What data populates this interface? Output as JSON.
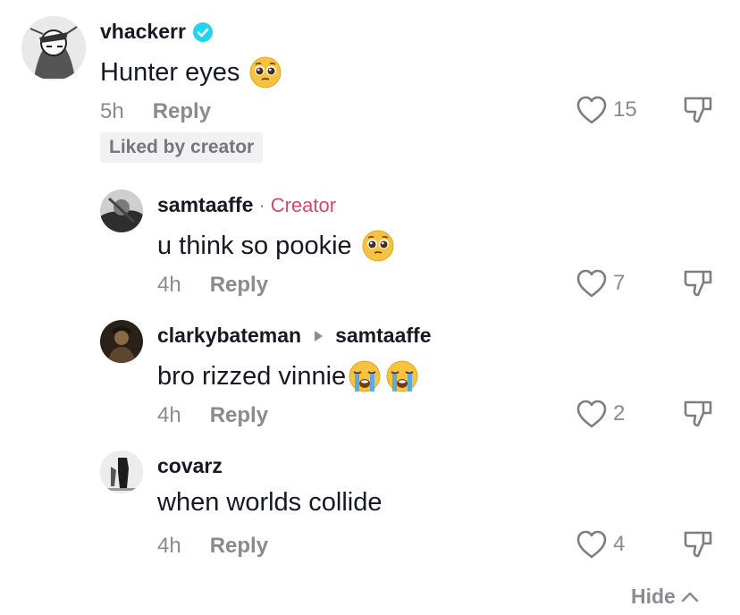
{
  "comments": [
    {
      "username": "vhackerr",
      "verified": true,
      "text": "Hunter eyes",
      "emojis": [
        "pleading-face"
      ],
      "time": "5h",
      "reply_label": "Reply",
      "likes": "15",
      "liked_by_creator": "Liked by creator"
    },
    {
      "username": "samtaaffe",
      "separator": "·",
      "creator_tag": "Creator",
      "text": "u think so pookie",
      "emojis": [
        "pleading-face"
      ],
      "time": "4h",
      "reply_label": "Reply",
      "likes": "7"
    },
    {
      "username": "clarkybateman",
      "replying_to": "samtaaffe",
      "text": "bro rizzed vinnie",
      "emojis": [
        "loudly-crying-face",
        "loudly-crying-face"
      ],
      "time": "4h",
      "reply_label": "Reply",
      "likes": "2"
    },
    {
      "username": "covarz",
      "text": "when worlds collide",
      "time": "4h",
      "reply_label": "Reply",
      "likes": "4"
    }
  ],
  "hide_label": "Hide",
  "colors": {
    "creator_tag": "#d44868",
    "verified": "#20d5ec",
    "muted": "#8a8b91"
  }
}
